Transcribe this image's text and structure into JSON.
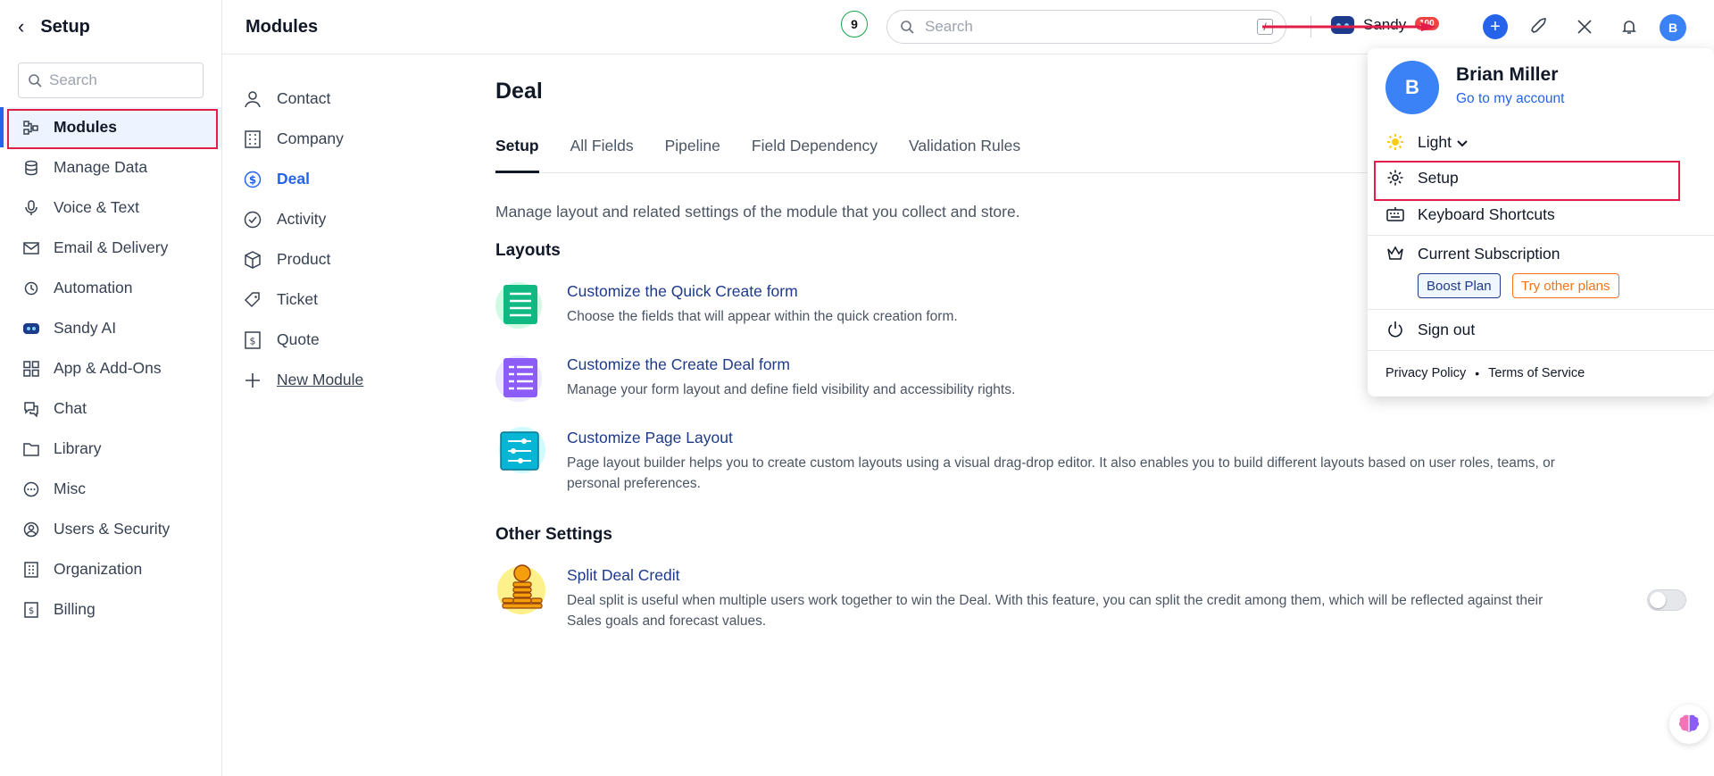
{
  "sidebar": {
    "title": "Setup",
    "search_placeholder": "Search",
    "items": [
      {
        "label": "Modules"
      },
      {
        "label": "Manage Data"
      },
      {
        "label": "Voice & Text"
      },
      {
        "label": "Email & Delivery"
      },
      {
        "label": "Automation"
      },
      {
        "label": "Sandy AI"
      },
      {
        "label": "App & Add-Ons"
      },
      {
        "label": "Chat"
      },
      {
        "label": "Library"
      },
      {
        "label": "Misc"
      },
      {
        "label": "Users & Security"
      },
      {
        "label": "Organization"
      },
      {
        "label": "Billing"
      }
    ]
  },
  "header": {
    "title": "Modules",
    "badge_count": "9",
    "search_placeholder": "Search",
    "search_shortcut": "/",
    "sandy_label": "Sandy",
    "notification_count": "100",
    "avatar_initial": "B"
  },
  "modules": [
    {
      "label": "Contact"
    },
    {
      "label": "Company"
    },
    {
      "label": "Deal"
    },
    {
      "label": "Activity"
    },
    {
      "label": "Product"
    },
    {
      "label": "Ticket"
    },
    {
      "label": "Quote"
    },
    {
      "label": "New Module"
    }
  ],
  "main": {
    "title": "Deal",
    "tabs": [
      {
        "label": "Setup"
      },
      {
        "label": "All Fields"
      },
      {
        "label": "Pipeline"
      },
      {
        "label": "Field Dependency"
      },
      {
        "label": "Validation Rules"
      }
    ],
    "description": "Manage layout and related settings of the module that you collect and store.",
    "layouts_heading": "Layouts",
    "layouts": [
      {
        "title": "Customize the Quick Create form",
        "text": "Choose the fields that will appear within the quick creation form."
      },
      {
        "title": "Customize the Create Deal form",
        "text": "Manage your form layout and define field visibility and accessibility rights."
      },
      {
        "title": "Customize Page Layout",
        "text": "Page layout builder helps you to create custom layouts using a visual drag-drop editor. It also enables you to build different layouts based on user roles, teams, or personal preferences."
      }
    ],
    "other_heading": "Other Settings",
    "other": [
      {
        "title": "Split Deal Credit",
        "text": "Deal split is useful when multiple users work together to win the Deal. With this feature, you can split the credit among them, which will be reflected against their Sales goals and forecast values."
      }
    ]
  },
  "user_menu": {
    "initial": "B",
    "name": "Brian Miller",
    "account_link": "Go to my account",
    "theme": "Light",
    "setup": "Setup",
    "shortcuts": "Keyboard Shortcuts",
    "subscription": "Current Subscription",
    "boost_plan": "Boost Plan",
    "other_plans": "Try other plans",
    "sign_out": "Sign out",
    "privacy": "Privacy Policy",
    "dot": "•",
    "terms": "Terms of Service"
  },
  "colors": {
    "accent": "#2563eb",
    "highlight_box": "#e11d48",
    "plan_other": "#f97316"
  }
}
